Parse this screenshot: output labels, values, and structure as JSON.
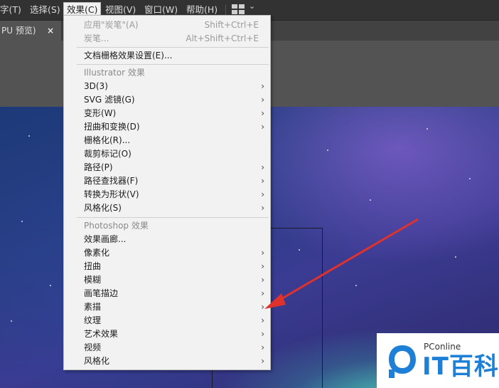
{
  "menubar": {
    "items": [
      {
        "label": "字(T)"
      },
      {
        "label": "选择(S)"
      },
      {
        "label": "效果(C)"
      },
      {
        "label": "视图(V)"
      },
      {
        "label": "窗口(W)"
      },
      {
        "label": "帮助(H)"
      }
    ],
    "active_index": 2,
    "workspace_icon": "layout-grid-icon",
    "chevron_icon": "chevron-down-icon"
  },
  "tab": {
    "label": "PU 预览)",
    "close_icon": "close-icon",
    "close_glyph": "×"
  },
  "effect_menu": {
    "items": [
      {
        "label": "应用\"炭笔\"(A)",
        "shortcut": "Shift+Ctrl+E",
        "disabled": true,
        "submenu": false
      },
      {
        "label": "炭笔...",
        "shortcut": "Alt+Shift+Ctrl+E",
        "disabled": true,
        "submenu": false
      },
      {
        "label": "文档栅格效果设置(E)...",
        "shortcut": "",
        "disabled": false,
        "submenu": false
      },
      {
        "label": "Illustrator 效果",
        "section": true
      },
      {
        "label": "3D(3)",
        "submenu": true
      },
      {
        "label": "SVG 滤镜(G)",
        "submenu": true
      },
      {
        "label": "变形(W)",
        "submenu": true
      },
      {
        "label": "扭曲和变换(D)",
        "submenu": true
      },
      {
        "label": "栅格化(R)...",
        "submenu": false
      },
      {
        "label": "裁剪标记(O)",
        "submenu": false
      },
      {
        "label": "路径(P)",
        "submenu": true
      },
      {
        "label": "路径查找器(F)",
        "submenu": true
      },
      {
        "label": "转换为形状(V)",
        "submenu": true
      },
      {
        "label": "风格化(S)",
        "submenu": true
      },
      {
        "label": "Photoshop 效果",
        "section": true
      },
      {
        "label": "效果画廊...",
        "submenu": false
      },
      {
        "label": "像素化",
        "submenu": true
      },
      {
        "label": "扭曲",
        "submenu": true
      },
      {
        "label": "模糊",
        "submenu": true
      },
      {
        "label": "画笔描边",
        "submenu": true
      },
      {
        "label": "素描",
        "submenu": true
      },
      {
        "label": "纹理",
        "submenu": true
      },
      {
        "label": "艺术效果",
        "submenu": true
      },
      {
        "label": "视频",
        "submenu": true
      },
      {
        "label": "风格化",
        "submenu": true
      }
    ],
    "submenu_glyph": "›"
  },
  "logo": {
    "brand": "PConline",
    "name": "IT百科",
    "color": "#1d7fd6"
  },
  "colors": {
    "arrow": "#e0322d",
    "menubar": "#323232",
    "menu_bg": "#f2f2f2"
  }
}
